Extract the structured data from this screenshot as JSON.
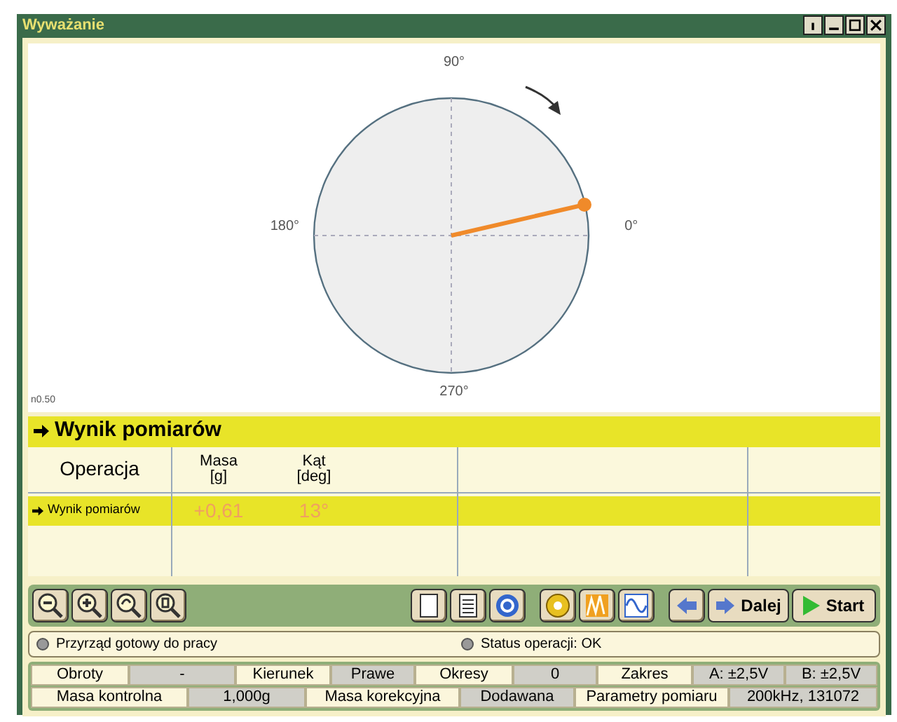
{
  "window": {
    "title": "Wyważanie"
  },
  "plot": {
    "labels": {
      "top": "90°",
      "left": "180°",
      "right": "0°",
      "bottom": "270°"
    },
    "scale": "n0.50"
  },
  "results": {
    "title": "Wynik pomiarów",
    "columns": [
      {
        "label": "Operacja"
      },
      {
        "label": "Masa",
        "unit": "[g]"
      },
      {
        "label": "Kąt",
        "unit": "[deg]"
      }
    ],
    "rows": [
      {
        "operation": "Wynik pomiarów",
        "mass": "+0,61",
        "angle": "13°",
        "selected": true
      }
    ]
  },
  "toolbar": {
    "dalej": "Dalej",
    "start": "Start"
  },
  "status": [
    "Przyrząd gotowy do pracy",
    "Status operacji: OK"
  ],
  "info": [
    [
      {
        "kind": "label",
        "text": "Obroty"
      },
      {
        "kind": "value",
        "text": "-"
      },
      {
        "kind": "label",
        "text": "Kierunek"
      },
      {
        "kind": "value",
        "text": "Prawe"
      },
      {
        "kind": "label",
        "text": "Okresy"
      },
      {
        "kind": "value",
        "text": "0"
      },
      {
        "kind": "label",
        "text": "Zakres"
      },
      {
        "kind": "value",
        "text": "A: ±2,5V"
      },
      {
        "kind": "value",
        "text": "B: ±2,5V"
      }
    ],
    [
      {
        "kind": "label",
        "text": "Masa kontrolna"
      },
      {
        "kind": "value",
        "text": "1,000g"
      },
      {
        "kind": "label",
        "text": "Masa korekcyjna"
      },
      {
        "kind": "value",
        "text": "Dodawana"
      },
      {
        "kind": "label",
        "text": "Parametry pomiaru"
      },
      {
        "kind": "value",
        "text": "200kHz, 131072"
      }
    ]
  ]
}
